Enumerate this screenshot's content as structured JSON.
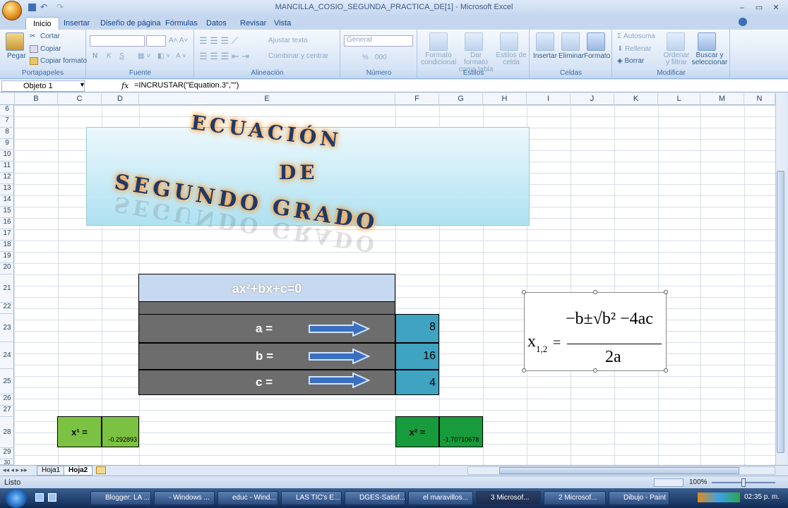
{
  "window": {
    "title": "MANCILLA_COSIO_SEGUNDA_PRACTICA_DE[1] - Microsoft Excel",
    "min": "–",
    "restore": "▭",
    "close": "✕"
  },
  "tabs": [
    "Inicio",
    "Insertar",
    "Diseño de página",
    "Fórmulas",
    "Datos",
    "Revisar",
    "Vista"
  ],
  "ribbon": {
    "clipboard": {
      "label": "Portapapeles",
      "paste": "Pegar",
      "cut": "Cortar",
      "copy": "Copiar",
      "format_painter": "Copiar formato"
    },
    "font": {
      "label": "Fuente",
      "bold": "N",
      "italic": "K",
      "underline": "S"
    },
    "alignment": {
      "label": "Alineación",
      "wrap": "Ajustar texto",
      "merge": "Combinar y centrar"
    },
    "number": {
      "label": "Número",
      "format": "General",
      "percent": "%",
      "thousands": "000"
    },
    "styles": {
      "label": "Estilos",
      "cond": "Formato condicional",
      "table": "Dar formato como tabla",
      "cell": "Estilos de celda"
    },
    "cells": {
      "label": "Celdas",
      "insert": "Insertar",
      "delete": "Eliminar",
      "format": "Formato"
    },
    "edit": {
      "label": "Modificar",
      "autosum": "Autosuma",
      "fill": "Rellenar",
      "clear": "Borrar",
      "sort": "Ordenar y filtrar",
      "find": "Buscar y seleccionar"
    }
  },
  "formula_bar": {
    "name_box": "Objeto 1",
    "fx": "fx",
    "formula": "=INCRUSTAR(\"Equation.3\",\"\")"
  },
  "columns": [
    "B",
    "C",
    "D",
    "E",
    "F",
    "G",
    "H",
    "I",
    "J",
    "K",
    "L",
    "M",
    "N"
  ],
  "rows": [
    "6",
    "7",
    "8",
    "9",
    "10",
    "11",
    "12",
    "13",
    "14",
    "15",
    "16",
    "17",
    "18",
    "19",
    "20",
    "21",
    "22",
    "23",
    "24",
    "25",
    "26",
    "27",
    "28",
    "29",
    "30"
  ],
  "banner": {
    "line1": "ECUACIÓN",
    "line2": "DE",
    "line3": "SEGUNDO GRADO"
  },
  "equation_row": "ax²+bx+c=0",
  "coefs": [
    {
      "label": "a =",
      "value": "8"
    },
    {
      "label": "b =",
      "value": "16"
    },
    {
      "label": "c =",
      "value": "4"
    }
  ],
  "results": {
    "x1_label": "x¹ =",
    "x1_value": "-0.292893",
    "x2_label": "x² =",
    "x2_value": "-1.70710678"
  },
  "formula_img": {
    "lhs": "x",
    "sub": "1,2",
    "eq": "=",
    "num": "−b±√b² −4ac",
    "den": "2a"
  },
  "sheets": [
    "Hoja1",
    "Hoja2"
  ],
  "status": {
    "ready": "Listo",
    "zoom": "100%"
  },
  "taskbar": {
    "items": [
      "Blogger: LA ...",
      "- Windows ...",
      "educ - Wind...",
      "LAS TIC's E...",
      "DGES-Satisf...",
      "el maravillos...",
      "3 Microsof...",
      "2 Microsof...",
      "Dibujo - Paint"
    ],
    "clock": "02:35 p. m."
  }
}
